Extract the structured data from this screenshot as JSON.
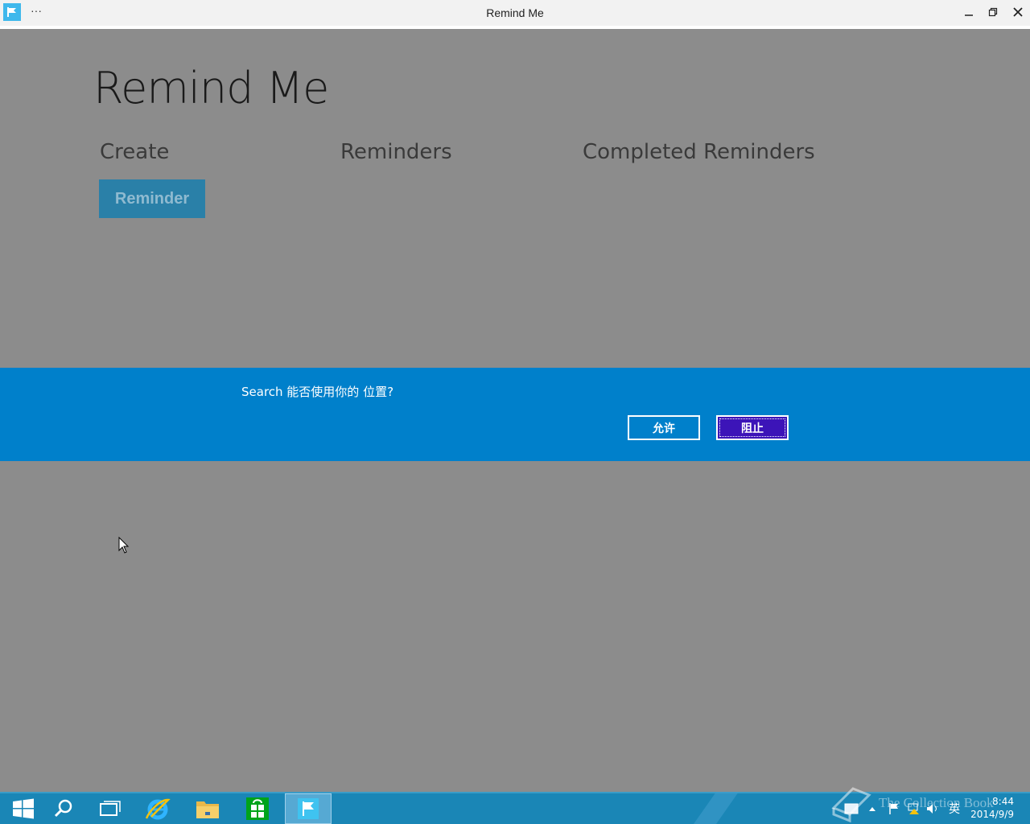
{
  "window": {
    "title": "Remind Me",
    "more_label": "···",
    "minimize_label": "minimize",
    "restore_label": "restore",
    "close_label": "close"
  },
  "app": {
    "heading": "Remind Me",
    "sections": {
      "create": "Create",
      "reminders": "Reminders",
      "completed": "Completed Reminders"
    },
    "reminder_button": "Reminder"
  },
  "permission": {
    "message": "Search 能否使用你的 位置?",
    "allow_label": "允许",
    "block_label": "阻止"
  },
  "taskbar": {
    "apps": [
      "start-icon",
      "search-icon",
      "task-view-icon",
      "internet-explorer-icon",
      "file-explorer-icon",
      "store-icon",
      "remind-me-icon"
    ],
    "ime_label": "英",
    "time": "8:44",
    "date": "2014/9/9"
  },
  "watermark": "The Collection Book",
  "colors": {
    "banner": "#0080cb",
    "block_button": "#3c14b8",
    "reminder_button": "#2a80a8",
    "taskbar": "#1a86b6",
    "app_accent": "#3fb8ec"
  }
}
